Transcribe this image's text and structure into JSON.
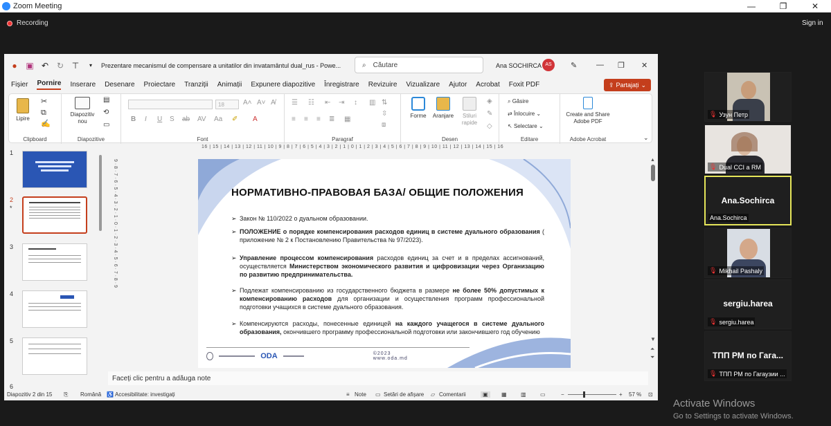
{
  "zoom": {
    "title": "Zoom Meeting",
    "recording": "Recording",
    "signin": "Sign in"
  },
  "ppt": {
    "doc_title": "Prezentare mecanismul de compensare a unitatilor din invatamântul dual_rus  -  Powe...",
    "search_placeholder": "Căutare",
    "user_name": "Ana SOCHIRCA",
    "avatar_initials": "AS",
    "menu": [
      "Fișier",
      "Pornire",
      "Inserare",
      "Desenare",
      "Proiectare",
      "Tranziții",
      "Animații",
      "Expunere diapozitive",
      "Înregistrare",
      "Revizuire",
      "Vizualizare",
      "Ajutor",
      "Acrobat",
      "Foxit PDF"
    ],
    "share": "Partajați",
    "ribbon": {
      "paste": "Lipire",
      "clipboard": "Clipboard",
      "new_slide_1": "Diapozitiv",
      "new_slide_2": "nou",
      "slides_group": "Diapozitive",
      "font_size": "18",
      "font_group": "Font",
      "paragraph_group": "Paragraf",
      "shapes": "Forme",
      "arrange": "Aranjare",
      "quick_styles_1": "Stiluri",
      "quick_styles_2": "rapide",
      "draw_group": "Desen",
      "find": "Găsire",
      "replace": "Înlocuire",
      "select": "Selectare",
      "edit_group": "Editare",
      "adobe_1": "Create and Share",
      "adobe_2": "Adobe PDF",
      "adobe_group": "Adobe Acrobat"
    },
    "slide_numbers": [
      "1",
      "2",
      "3",
      "4",
      "5",
      "6"
    ],
    "slide_star": "*",
    "ruler_top": "16 | 15 | 14 | 13 | 12 | 11 | 10 | 9 | 8 | 7 | 6 | 5 | 4 | 3 | 2 | 1 | 0 | 1 | 2 | 3 | 4 | 5 | 6 | 7 | 8 | 9 | 10 | 11 | 12 | 13 | 14 | 15 | 16",
    "ruler_left": "9 · 8 · 7 · 6 · 5 · 4 · 3 · 2 · 1 · 0 · 1 · 2 · 3 · 4 · 5 · 6 · 7 · 8 · 9",
    "slide": {
      "heading": "НОРМАТИВНО-ПРАВОВАЯ БАЗА/ ОБЩИЕ ПОЛОЖЕНИЯ",
      "b1": "Закон № 110/2022 о дуальном образовании.",
      "b2_bold": "ПОЛОЖЕНИЕ о порядке компенсирования расходов единиц в системе дуального образования",
      "b2_rest": " ( приложение № 2 к Постановлению Правительства № 97/2023).",
      "b3_bold1": "Управление процессом компенсирования",
      "b3_mid": " расходов единиц за счет и в пределах ассигнований, осуществляется ",
      "b3_bold2": "Министерством экономического развития и цифровизации через Организацию по развитию предпринимательства.",
      "b4_start": "Подлежат компенсированию из государственного бюджета в размере ",
      "b4_bold": "не более 50% допустимых к компенсированию расходов",
      "b4_rest": " для организации и осуществления программ профессиональной подготовки учащихся в системе дуального образования.",
      "b5_start": "Компенсируются расходы, понесенные единицей ",
      "b5_bold": "на каждого учащегося в системе дуального образования,",
      "b5_rest": " окончившего программу профессиональной подготовки или закончившего год обучению",
      "footer_oda": "ODA",
      "footer_year": "©2023   www.oda.md"
    },
    "notes_placeholder": "Faceți clic pentru a adăuga note",
    "status": {
      "slide_count": "Diapozitiv 2 din 15",
      "language": "Română",
      "accessibility": "Accesibilitate: investigați",
      "notes": "Note",
      "display": "Setări de afișare",
      "comments": "Comentarii",
      "zoom": "57 %"
    }
  },
  "participants": [
    {
      "name": "Узун Петр",
      "muted": true,
      "video": true
    },
    {
      "name": "Dual CCI a RM",
      "muted": true,
      "video": true
    },
    {
      "name": "Ana.Sochirca",
      "big": "Ana.Sochirca",
      "muted": false,
      "video": false,
      "active": true
    },
    {
      "name": "Mikhail Pashaly",
      "muted": true,
      "video": true
    },
    {
      "name": "sergiu.harea",
      "big": "sergiu.harea",
      "muted": true,
      "video": false
    },
    {
      "name": "ТПП РМ по Гагаузии ...",
      "big": "ТПП РМ по Гага...",
      "muted": true,
      "video": false
    }
  ],
  "windows": {
    "activate_title": "Activate Windows",
    "activate_sub": "Go to Settings to activate Windows."
  },
  "colors": {
    "ppt_accent": "#c43e1c",
    "zoom_blue": "#2d8cff",
    "active_speaker": "#e6e65a"
  }
}
